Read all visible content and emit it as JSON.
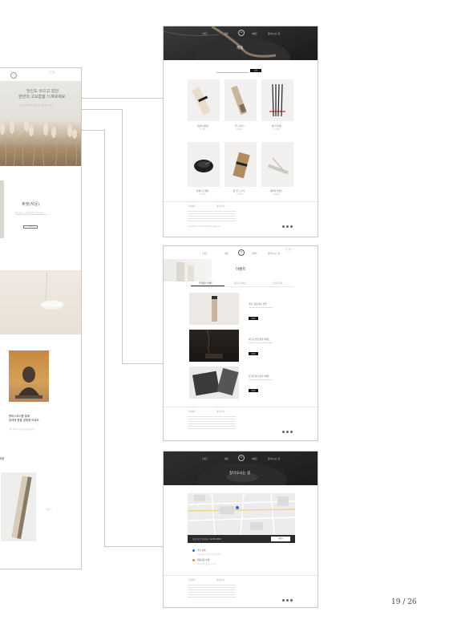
{
  "page_number": "19 / 26",
  "main_page": {
    "top_right_links": "로그인",
    "hero_text": "당신도 쓰으고 있던\n현안의 고요함을 느껴보세요.",
    "hero_subtext": "향기로운 하루의 시작과 끝, 나를 위한 작은 쉼",
    "section_title": "휴뎃(자운)",
    "section_desc": "향이 머무는 공간에서 잠시 쉬어가세요.",
    "section_button": "더보기",
    "feature_text": "향피스토리를 통해\n잠재적 향을 경험해 보세요.",
    "feature_subtext": "향의 역사와 이야기를 전해드립니다",
    "bottom_title": "제품",
    "side_link": "더보기 >"
  },
  "product_page": {
    "nav": [
      "브랜드",
      "제품",
      "이벤트",
      "찾아오시는 길"
    ],
    "title": "제품",
    "search_button": "검색",
    "products": [
      {
        "name": "인센스(향봉)",
        "price": "15,000"
      },
      {
        "name": "우드(나무)",
        "price": "18,000"
      },
      {
        "name": "향(석 인경)",
        "price": "12,000"
      },
      {
        "name": "인센스 트레이",
        "price": "22,000"
      },
      {
        "name": "향 우드 스틱",
        "price": "16,000"
      },
      {
        "name": "세라믹 인센스",
        "price": "25,000"
      }
    ],
    "footer_cols": [
      "고객센터",
      "회사소개"
    ],
    "footer_text": "Copyright © 2020 all rights reserved"
  },
  "event_page": {
    "top_right_links": "로그인",
    "nav": [
      "브랜드",
      "제품",
      "이벤트",
      "찾아오시는 길"
    ],
    "title": "이벤트",
    "tabs": [
      "진행중인 이벤트",
      "종료된 이벤트",
      "당첨자 발표"
    ],
    "events": [
      {
        "title": "가을, 향과 마음 산책",
        "button": "자세히"
      },
      {
        "title": "어두운 밤을 밝힐 이벤트",
        "button": "자세히"
      },
      {
        "title": "당신의 향기 찾기 이벤트",
        "button": "자세히"
      }
    ],
    "footer_cols": [
      "고객센터",
      "회사소개"
    ]
  },
  "location_page": {
    "nav": [
      "브랜드",
      "제품",
      "이벤트",
      "찾아오시는 길"
    ],
    "title": "찾아오시는 길",
    "map_bar_text": "서울 종로구 인사동길 · 02-000-0000",
    "map_button": "길찾기",
    "info": [
      {
        "label": "주소 안내",
        "text": "서울특별시 종로구 인사동길 00"
      },
      {
        "label": "대중교통 안내",
        "text": "안국역 6번 출구 도보 5분"
      }
    ],
    "footer_cols": [
      "고객센터",
      "회사소개"
    ]
  }
}
